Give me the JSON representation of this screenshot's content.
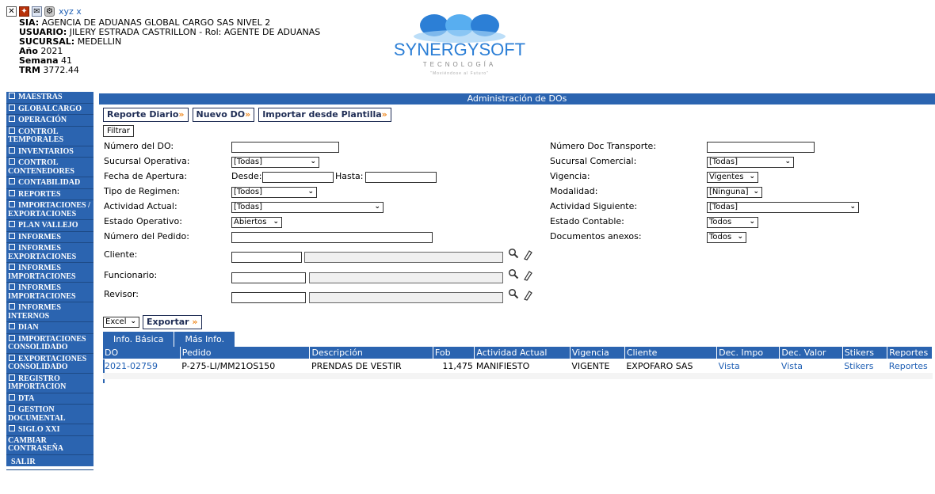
{
  "header": {
    "user_link": "xyz x",
    "sia_label": "SIA:",
    "sia_value": "AGENCIA DE ADUANAS GLOBAL CARGO SAS NIVEL 2",
    "usuario_label": "USUARIO:",
    "usuario_value": "JILERY ESTRADA CASTRILLON - Rol: AGENTE DE ADUANAS",
    "sucursal_label": "SUCURSAL:",
    "sucursal_value": "MEDELLIN",
    "anio_label": "Año",
    "anio_value": "2021",
    "semana_label": "Semana",
    "semana_value": "41",
    "trm_label": "TRM",
    "trm_value": "3772.44",
    "logo": {
      "name": "SYNERGYSOFT",
      "sub": "TECNOLOGÍA",
      "tagline": "\"Moviéndose al Futuro\""
    },
    "colors": {
      "logo_blue": "#2c7fd6",
      "logo_light": "#58aef0"
    }
  },
  "sidebar": {
    "items": [
      "MAESTRAS",
      "GLOBALCARGO",
      "OPERACIÓN",
      "CONTROL TEMPORALES",
      "INVENTARIOS",
      "CONTROL CONTENEDORES",
      "CONTABILIDAD",
      "REPORTES",
      "IMPORTACIONES / EXPORTACIONES",
      "PLAN VALLEJO",
      "INFORMES",
      "INFORMES EXPORTACIONES",
      "INFORMES IMPORTACIONES",
      "INFORMES IMPORTACIONES",
      "INFORMES INTERNOS",
      "DIAN",
      "IMPORTACIONES CONSOLIDADO",
      "EXPORTACIONES CONSOLIDADO",
      "REGISTRO IMPORTACION",
      "DTA",
      "GESTION DOCUMENTAL",
      "SIGLO XXI"
    ],
    "change_password": "CAMBIAR CONTRASEÑA",
    "logout": "SALIR",
    "color": "#2b64b0"
  },
  "main": {
    "title": "Administración de DOs",
    "buttons": {
      "reporte_diario": "Reporte Diario",
      "nuevo_do": "Nuevo DO",
      "importar": "Importar desde Plantilla",
      "arrow": "»"
    },
    "filter_button": "Filtrar",
    "form": {
      "numero_do": "Número del DO:",
      "sucursal_operativa": "Sucursal Operativa:",
      "sucursal_operativa_value": "[Todas]",
      "fecha_apertura": "Fecha de Apertura:",
      "desde": "Desde:",
      "hasta": "Hasta:",
      "tipo_regimen": "Tipo de Regimen:",
      "tipo_regimen_value": "[Todos]",
      "actividad_actual": "Actividad Actual:",
      "actividad_actual_value": "[Todas]",
      "estado_operativo": "Estado Operativo:",
      "estado_operativo_value": "Abiertos",
      "numero_pedido": "Número del Pedido:",
      "cliente": "Cliente:",
      "funcionario": "Funcionario:",
      "revisor": "Revisor:",
      "numero_doc_transporte": "Número Doc Transporte:",
      "sucursal_comercial": "Sucursal Comercial:",
      "sucursal_comercial_value": "[Todas]",
      "vigencia": "Vigencia:",
      "vigencia_value": "Vigentes",
      "modalidad": "Modalidad:",
      "modalidad_value": "[Ninguna]",
      "actividad_siguiente": "Actividad Siguiente:",
      "actividad_siguiente_value": "[Todas]",
      "estado_contable": "Estado Contable:",
      "estado_contable_value": "Todos",
      "documentos_anexos": "Documentos anexos:",
      "documentos_anexos_value": "Todos"
    },
    "export": {
      "format": "Excel",
      "button": "Exportar",
      "arrow": "»"
    },
    "tabs": [
      "Info. Básica",
      "Más Info."
    ],
    "table": {
      "headers": [
        "DO",
        "Pedido",
        "Descripción",
        "Fob",
        "Actividad Actual",
        "Vigencia",
        "Cliente",
        "Dec. Impo",
        "Dec. Valor",
        "Stikers",
        "Reportes"
      ],
      "rows": [
        [
          "2021-02759",
          "P-275-LI/MM21OS150",
          "PRENDAS DE VESTIR",
          "11,475",
          "MANIFIESTO",
          "VIGENTE",
          "EXPOFARO SAS",
          "Vista",
          "Vista",
          "Stikers",
          "Reportes"
        ]
      ]
    }
  }
}
